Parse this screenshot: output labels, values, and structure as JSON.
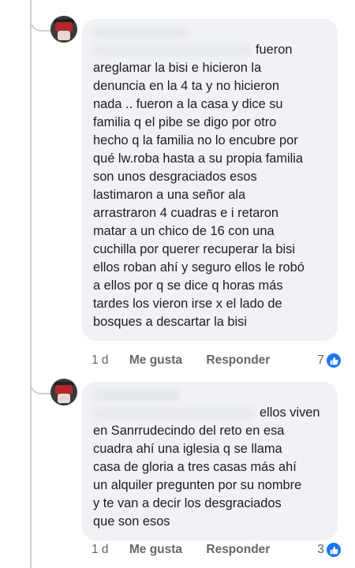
{
  "comments": [
    {
      "text_first_line": "fueron",
      "text": "areglamar la bisi e hicieron la\ndenuncia en la 4 ta y no hicieron\nnada .. fueron a la casa y dice su\nfamilia q el pibe se digo por otro\nhecho q la familia no lo encubre por\nqué lw.roba hasta a su propia familia\nson unos desgraciados esos\nlastimaron a una señor ala\narrastraron 4 cuadras e i retaron\nmatar a un chico de 16 con una\ncuchilla por querer recuperar la bisi\nellos roban ahí y seguro ellos le robó\na ellos por q se dice q horas más\ntardes los vieron irse x el lado de\nbosques a descartar la bisi",
      "time": "1 d",
      "like_label": "Me gusta",
      "reply_label": "Responder",
      "reaction_count": "7"
    },
    {
      "text_first_line": "ellos viven",
      "text": "en Sanrrudecindo del reto en esa\ncuadra ahí una iglesia q se llama\ncasa de gloria a tres casas más ahí\nun alquiler pregunten por su nombre\ny te van a decir los desgraciados\nque son esos",
      "time": "1 d",
      "like_label": "Me gusta",
      "reply_label": "Responder",
      "reaction_count": "3"
    }
  ],
  "icons": {
    "like": "thumbs-up-icon"
  },
  "colors": {
    "bubble": "#f0f2f5",
    "accent": "#1877f2",
    "muted": "#65676b"
  }
}
